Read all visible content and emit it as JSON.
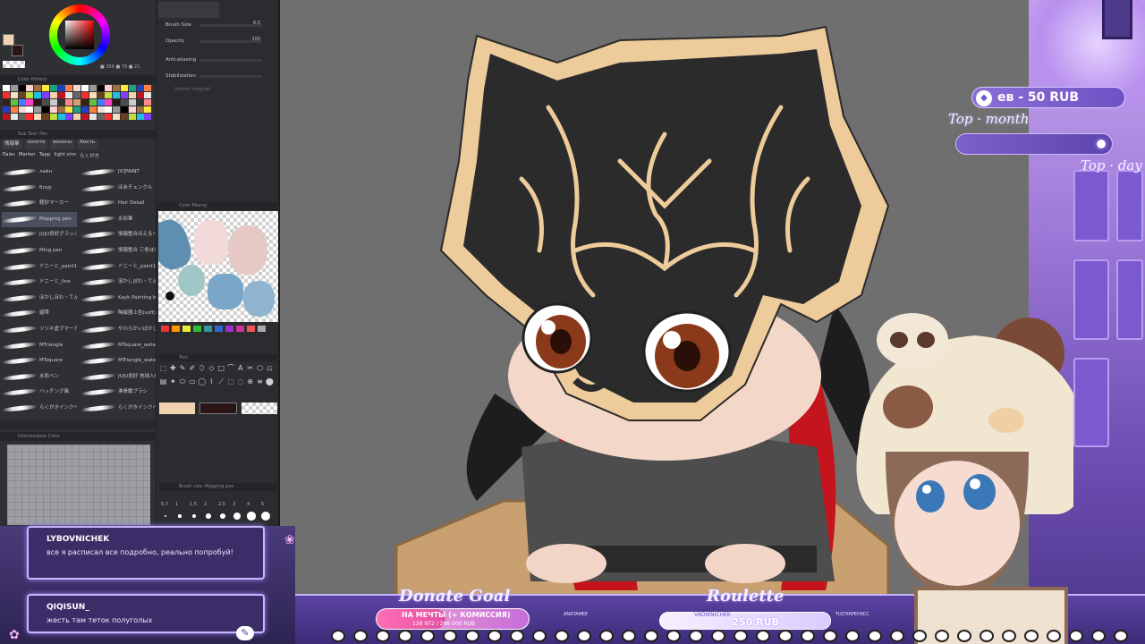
{
  "colors": {
    "main_color": "#f0d3b0",
    "sub_color": "#2a1416",
    "accent_purple": "#7b5ad0",
    "canvas_gray": "#6f6f6f"
  },
  "color_wheel": {
    "readout": "■ 359 ■ 78 ■ 21"
  },
  "color_history": {
    "title": "Color History"
  },
  "sub_tool_panel": {
    "title": "Sub Tool: Pen",
    "tabs": [
      "情報筆",
      "золото",
      "волосы",
      "Кисть"
    ],
    "tabs2": [
      "Лайн",
      "Marker",
      "Tapp",
      "light stro",
      "らくがき"
    ],
    "brushes_left": [
      "лайн",
      "блур",
      "軽妙マーカー",
      "Mapping pen",
      "JUJU良好グラッジ",
      "Ming pen",
      "ドニーと_paint1",
      "ドニーと_line",
      "ほかしほわ・てんたいブラシ",
      "縮帯",
      "ツリキ虚ブマーカー",
      "MTriangle",
      "MTsquare",
      "水彩ペン",
      "ハッチング風",
      "らくがきインクペン"
    ],
    "brushes_right": [
      "[K]PAINT",
      "ほあチェンクル",
      "Hair Detail",
      "水彩筆",
      "情報整合ほえるペン改",
      "情報整合 三条ぼかしブラシ 2",
      "ドニーと_paint1",
      "溶かしぼわ・てんたいブラシ",
      "Kayk Painting brush",
      "陶磁器上色(soft)",
      "やわらかいぼかしブラシ",
      "MTsquare_watercolor",
      "MTriangle_watercolor",
      "JUJU良好 地球入伍惑",
      "沸骨鍛ブラシ",
      "らくがきインクペン"
    ]
  },
  "tool_properties": {
    "rows": [
      {
        "label": "Brush Size",
        "value": "6.5"
      },
      {
        "label": "Opacity",
        "value": "100"
      },
      {
        "label": "Anti-aliasing",
        "value": ""
      },
      {
        "label": "Stabilization",
        "value": ""
      }
    ],
    "vector_magnet": "Vector magnet"
  },
  "color_mixing": {
    "title": "Color Mixing"
  },
  "tool_panel": {
    "title": "Tool"
  },
  "intermediate_color": {
    "title": "Intermediate Color"
  },
  "brush_size_panel": {
    "title": "Brush size: Mapping pen",
    "sizes": [
      "0.7",
      "1",
      "1.5",
      "2",
      "2.5",
      "3",
      "4",
      "5"
    ]
  },
  "overlay": {
    "top_donor": "ев - 50 RUB",
    "top_month": "Top · month",
    "top_day": "Top · day"
  },
  "chat": {
    "messages": [
      {
        "user": "LYBOVNICHEK",
        "text": "все я расписал все подробно, реально попробуй!"
      },
      {
        "user": "QIQISUN_",
        "text": "жесть там теток полуголых"
      }
    ]
  },
  "bottom_bar": {
    "donate_title": "Donate Goal",
    "donate_goal_text": "НА МЕЧТЫ (+ КОМИССИЯ)",
    "donate_progress_text": "128 972 / 286 000 RUB",
    "donate_progress_fraction": 0.45,
    "roulette_title": "Roulette",
    "roulette_user": "VADIKNICHEK",
    "roulette_value": "- 250 RUB",
    "ticker_names": [
      "ANXTAMEE",
      "TUCIYAPEHXCC"
    ]
  }
}
